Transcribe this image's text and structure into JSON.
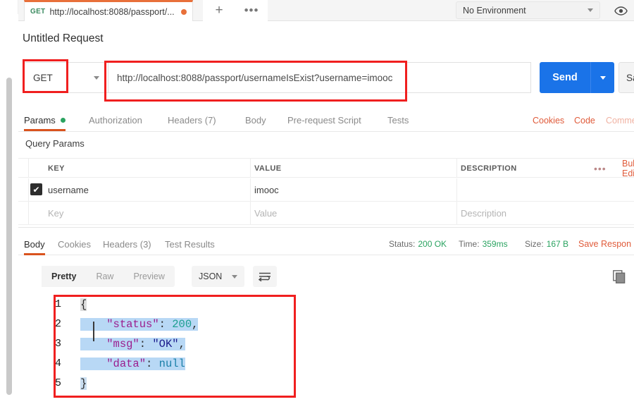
{
  "tabbar": {
    "request_tab": {
      "method": "GET",
      "url": "http://localhost:8088/passport/...",
      "unsaved_dot": "●"
    },
    "new_tab_icon": "+",
    "more_tabs_icon": "•••",
    "environment": {
      "selected": "No Environment"
    }
  },
  "request": {
    "title": "Untitled Request",
    "method": "GET",
    "url": "http://localhost:8088/passport/usernameIsExist?username=imooc",
    "send_label": "Send",
    "save_label": "Save",
    "tabs": [
      {
        "label": "Params",
        "active": true,
        "indicator": true
      },
      {
        "label": "Authorization",
        "active": false,
        "indicator": false
      },
      {
        "label": "Headers (7)",
        "active": false,
        "indicator": false
      },
      {
        "label": "Body",
        "active": false,
        "indicator": false
      },
      {
        "label": "Pre-request Script",
        "active": false,
        "indicator": false
      },
      {
        "label": "Tests",
        "active": false,
        "indicator": false
      }
    ],
    "links": [
      {
        "label": "Cookies",
        "faded": false
      },
      {
        "label": "Code",
        "faded": false
      },
      {
        "label": "Comments",
        "faded": true
      }
    ]
  },
  "params": {
    "section_title": "Query Params",
    "columns": [
      "KEY",
      "VALUE",
      "DESCRIPTION"
    ],
    "more_icon": "•••",
    "bulk_edit_label": "Bulk Edit",
    "rows": [
      {
        "checked": true,
        "key": "username",
        "value": "imooc",
        "description": ""
      }
    ],
    "placeholder_row": {
      "key": "Key",
      "value": "Value",
      "description": "Description"
    },
    "check_glyph": "✔"
  },
  "response": {
    "tabs": [
      {
        "label": "Body",
        "active": true
      },
      {
        "label": "Cookies",
        "active": false
      },
      {
        "label": "Headers (3)",
        "active": false
      },
      {
        "label": "Test Results",
        "active": false
      }
    ],
    "status_label": "Status:",
    "status_value": "200 OK",
    "time_label": "Time:",
    "time_value": "359ms",
    "size_label": "Size:",
    "size_value": "167 B",
    "save_response_label": "Save Respon",
    "view_modes": [
      {
        "label": "Pretty",
        "active": true
      },
      {
        "label": "Raw",
        "active": false
      },
      {
        "label": "Preview",
        "active": false
      }
    ],
    "format": "JSON",
    "body_lines": [
      {
        "n": "1",
        "text": "{"
      },
      {
        "n": "2",
        "text": "    \"status\": 200,"
      },
      {
        "n": "3",
        "text": "    \"msg\": \"OK\","
      },
      {
        "n": "4",
        "text": "    \"data\": null"
      },
      {
        "n": "5",
        "text": "}"
      }
    ],
    "body_json": {
      "status": 200,
      "msg": "OK",
      "data": null
    }
  },
  "colors": {
    "accent_orange": "#d9531e",
    "send_blue": "#1a73e8",
    "status_green": "#2aa360",
    "annotation_red": "#f01f1f",
    "selection_blue": "#b8d8f5"
  }
}
